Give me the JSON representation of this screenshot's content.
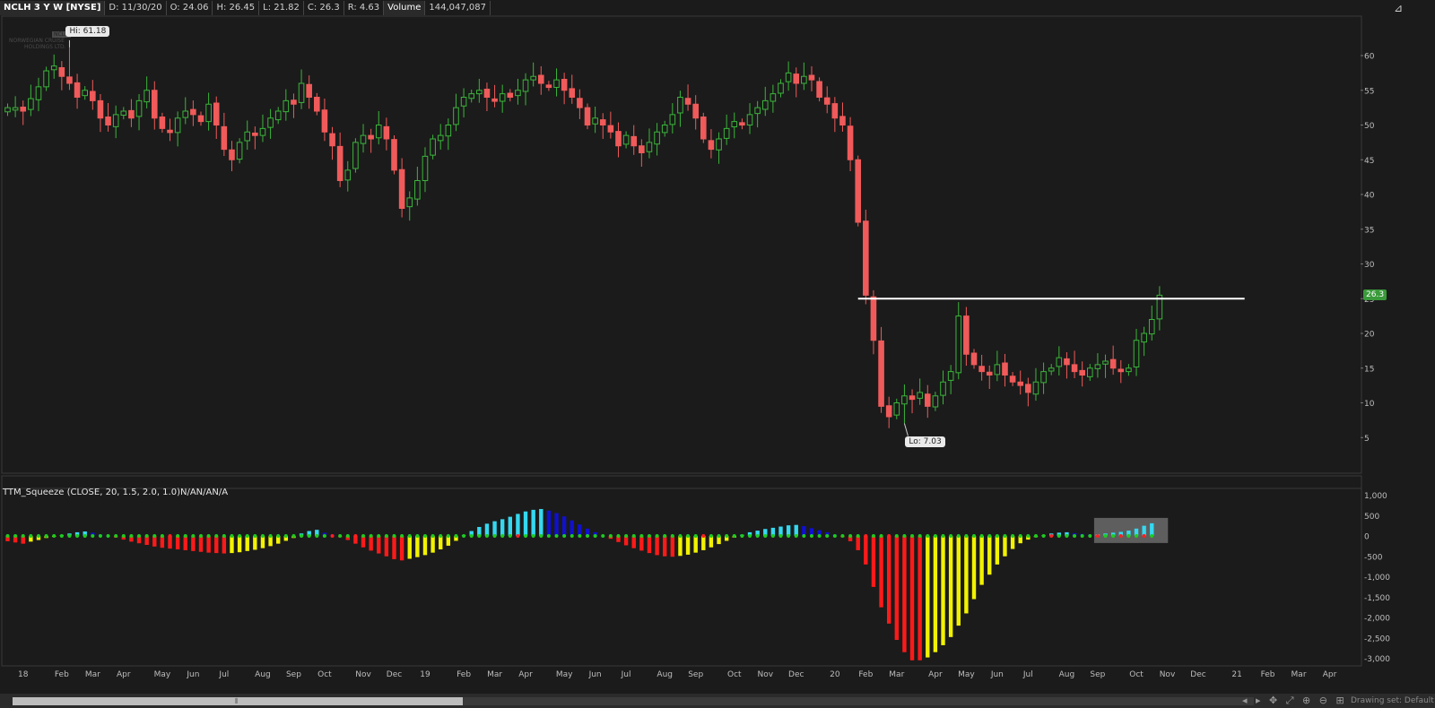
{
  "header": {
    "symbol": "NCLH 3 Y W [NYSE]",
    "date": "D: 11/30/20",
    "open": "O: 24.06",
    "high": "H: 26.45",
    "low": "L: 21.82",
    "close": "C: 26.3",
    "range": "R: 4.63",
    "volume_label": "Volume",
    "volume": "144,047,087"
  },
  "logo": {
    "mark": "NCLH",
    "line1": "NORWEGIAN CRUISE",
    "line2": "HOLDINGS LTD."
  },
  "annotations": {
    "hi": "Hi: 61.18",
    "lo": "Lo: 7.03",
    "last_price": "26.3"
  },
  "indicator_title": "TTM_Squeeze (CLOSE, 20, 1.5, 2.0, 1.0)N/AN/AN/A",
  "footer": {
    "tools": "◂ ▸ ✥ ⤢ ⊕ ⊖ ⊞",
    "drawing_set": "Drawing set: Default"
  },
  "colors": {
    "up": "#3bb53b",
    "down": "#f05a5a",
    "bg": "#1b1b1b",
    "hist_cyan": "#35d8f0",
    "hist_blue": "#1010d0",
    "hist_red": "#ff1a1a",
    "hist_yellow": "#f2f200",
    "dot_green": "#1ecb1e",
    "dot_red": "#ff2020"
  },
  "chart_data": [
    {
      "type": "candlestick",
      "title": "NCLH 3 Y W [NYSE]",
      "price_ticks": [
        5,
        10,
        15,
        20,
        25,
        30,
        35,
        40,
        45,
        50,
        55,
        60
      ],
      "ylim": [
        0,
        65
      ],
      "x_labels": [
        {
          "label": "18",
          "week": 2
        },
        {
          "label": "Feb",
          "week": 7
        },
        {
          "label": "Mar",
          "week": 11
        },
        {
          "label": "Apr",
          "week": 15
        },
        {
          "label": "May",
          "week": 20
        },
        {
          "label": "Jun",
          "week": 24
        },
        {
          "label": "Jul",
          "week": 28
        },
        {
          "label": "Aug",
          "week": 33
        },
        {
          "label": "Sep",
          "week": 37
        },
        {
          "label": "Oct",
          "week": 41
        },
        {
          "label": "Nov",
          "week": 46
        },
        {
          "label": "Dec",
          "week": 50
        },
        {
          "label": "19",
          "week": 54
        },
        {
          "label": "Feb",
          "week": 59
        },
        {
          "label": "Mar",
          "week": 63
        },
        {
          "label": "Apr",
          "week": 67
        },
        {
          "label": "May",
          "week": 72
        },
        {
          "label": "Jun",
          "week": 76
        },
        {
          "label": "Jul",
          "week": 80
        },
        {
          "label": "Aug",
          "week": 85
        },
        {
          "label": "Sep",
          "week": 89
        },
        {
          "label": "Oct",
          "week": 94
        },
        {
          "label": "Nov",
          "week": 98
        },
        {
          "label": "Dec",
          "week": 102
        },
        {
          "label": "20",
          "week": 107
        },
        {
          "label": "Feb",
          "week": 111
        },
        {
          "label": "Mar",
          "week": 115
        },
        {
          "label": "Apr",
          "week": 120
        },
        {
          "label": "May",
          "week": 124
        },
        {
          "label": "Jun",
          "week": 128
        },
        {
          "label": "Jul",
          "week": 132
        },
        {
          "label": "Aug",
          "week": 137
        },
        {
          "label": "Sep",
          "week": 141
        },
        {
          "label": "Oct",
          "week": 146
        },
        {
          "label": "Nov",
          "week": 150
        },
        {
          "label": "Dec",
          "week": 154
        },
        {
          "label": "21",
          "week": 159
        },
        {
          "label": "Feb",
          "week": 163
        },
        {
          "label": "Mar",
          "week": 167
        },
        {
          "label": "Apr",
          "week": 171
        }
      ],
      "hi": {
        "week": 8,
        "price": 61.18
      },
      "lo": {
        "week": 116,
        "price": 7.03
      },
      "resistance_line": {
        "price": 25,
        "from_week": 110,
        "to_week": 160
      },
      "closes": [
        52.5,
        52.5,
        52.0,
        53.8,
        55.5,
        57.8,
        58.5,
        57.0,
        56.0,
        54.0,
        55.0,
        53.5,
        51.0,
        50.0,
        51.5,
        52.0,
        51.0,
        53.5,
        55.0,
        51.0,
        49.5,
        49.0,
        51.0,
        52.0,
        51.5,
        50.5,
        53.0,
        50.0,
        46.5,
        45.0,
        47.5,
        49.0,
        48.5,
        49.5,
        51.0,
        52.0,
        53.5,
        53.0,
        56.0,
        54.0,
        52.0,
        49.0,
        47.0,
        42.0,
        43.5,
        47.5,
        48.5,
        48.0,
        50.0,
        48.0,
        43.5,
        38.0,
        39.5,
        42.0,
        45.5,
        48.0,
        48.5,
        50.0,
        52.5,
        54.0,
        54.5,
        55.0,
        54.0,
        53.5,
        54.5,
        54.0,
        55.0,
        56.5,
        57.0,
        56.0,
        55.5,
        56.5,
        55.0,
        54.0,
        52.5,
        50.0,
        51.0,
        50.0,
        49.0,
        47.0,
        48.5,
        47.0,
        46.0,
        47.5,
        49.0,
        50.0,
        51.5,
        54.0,
        53.0,
        51.0,
        48.0,
        46.5,
        48.0,
        49.5,
        50.5,
        50.0,
        51.5,
        52.5,
        53.5,
        54.5,
        56.0,
        57.5,
        56.0,
        57.0,
        56.5,
        54.0,
        53.0,
        51.0,
        50.0,
        45.0,
        36.0,
        25.5,
        19.0,
        9.5,
        8.0,
        10.0,
        11.0,
        10.5,
        11.5,
        9.5,
        11.0,
        13.0,
        14.5,
        22.5,
        17.0,
        15.5,
        14.5,
        14.0,
        15.5,
        14.0,
        13.0,
        12.5,
        11.5,
        13.0,
        14.5,
        15.0,
        16.5,
        15.5,
        14.5,
        14.0,
        15.0,
        15.5,
        16.0,
        15.0,
        14.5,
        15.0,
        19.0,
        20.0,
        22.0,
        25.5
      ]
    },
    {
      "type": "bar",
      "title": "TTM_Squeeze (CLOSE, 20, 1.5, 2.0, 1.0)",
      "ylim": [
        -3200,
        1100
      ],
      "y_ticks": [
        1000,
        500,
        0,
        -500,
        -1000,
        -1500,
        -2000,
        -2500,
        -3000
      ],
      "y_tick_labels": [
        "1,000",
        "500",
        "0",
        "-500",
        "-1,000",
        "-1,500",
        "-2,000",
        "-2,500",
        "-3,000"
      ],
      "values": [
        -130,
        -160,
        -190,
        -140,
        -100,
        -50,
        -20,
        20,
        60,
        90,
        110,
        80,
        40,
        0,
        -40,
        -90,
        -140,
        -180,
        -220,
        -260,
        -290,
        -310,
        -330,
        -350,
        -370,
        -390,
        -410,
        -420,
        -430,
        -420,
        -400,
        -370,
        -340,
        -300,
        -250,
        -190,
        -120,
        -50,
        60,
        120,
        150,
        80,
        30,
        -30,
        -100,
        -190,
        -280,
        -360,
        -430,
        -500,
        -570,
        -600,
        -560,
        -520,
        -470,
        -410,
        -330,
        -240,
        -120,
        20,
        120,
        220,
        300,
        360,
        410,
        470,
        540,
        600,
        640,
        660,
        620,
        560,
        480,
        380,
        280,
        180,
        90,
        10,
        -70,
        -150,
        -230,
        -300,
        -360,
        -420,
        -470,
        -500,
        -510,
        -490,
        -460,
        -410,
        -350,
        -280,
        -200,
        -120,
        -40,
        30,
        90,
        130,
        170,
        200,
        230,
        260,
        270,
        240,
        190,
        140,
        90,
        30,
        -30,
        -130,
        -350,
        -700,
        -1250,
        -1750,
        -2150,
        -2550,
        -2850,
        -3050,
        -3050,
        -2980,
        -2850,
        -2680,
        -2480,
        -2200,
        -1900,
        -1550,
        -1200,
        -950,
        -700,
        -500,
        -320,
        -180,
        -90,
        -30,
        20,
        60,
        80,
        90,
        70,
        50,
        30,
        40,
        60,
        80,
        100,
        130,
        180,
        250,
        310
      ]
    }
  ]
}
